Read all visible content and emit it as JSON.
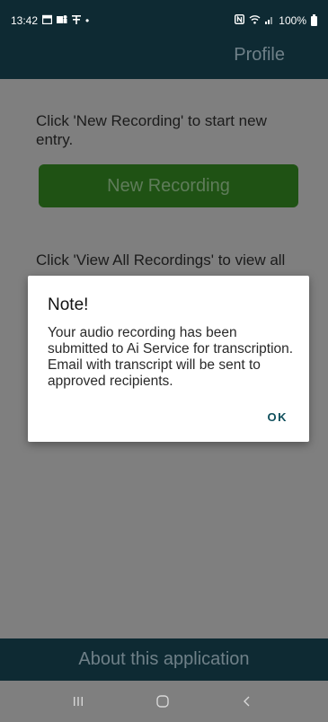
{
  "status_bar": {
    "time": "13:42",
    "dot": "•",
    "battery_text": "100%",
    "left_icons": [
      "calendar-icon",
      "teams-icon",
      "tuner-icon"
    ],
    "right_icons": [
      "nfc-icon",
      "wifi-icon",
      "signal-icon",
      "battery-icon"
    ]
  },
  "app_bar": {
    "title": "Profile"
  },
  "main": {
    "instruction_new": "Click 'New Recording' to start new entry.",
    "new_recording_label": "New Recording",
    "instruction_view": "Click 'View All Recordings' to view all"
  },
  "dialog": {
    "title": "Note!",
    "message": "Your audio recording has been submitted to Ai Service for transcription. Email with transcript will be sent to approved recipients.",
    "ok_label": "OK"
  },
  "footer": {
    "about_label": "About this application"
  },
  "nav": {
    "icons": [
      "recents-icon",
      "home-icon",
      "back-icon"
    ]
  },
  "colors": {
    "app_bar": "#0e2a33",
    "scrim": "#7f7f7f",
    "button_green": "#1f5214",
    "dialog_action": "#0f4f5c"
  }
}
